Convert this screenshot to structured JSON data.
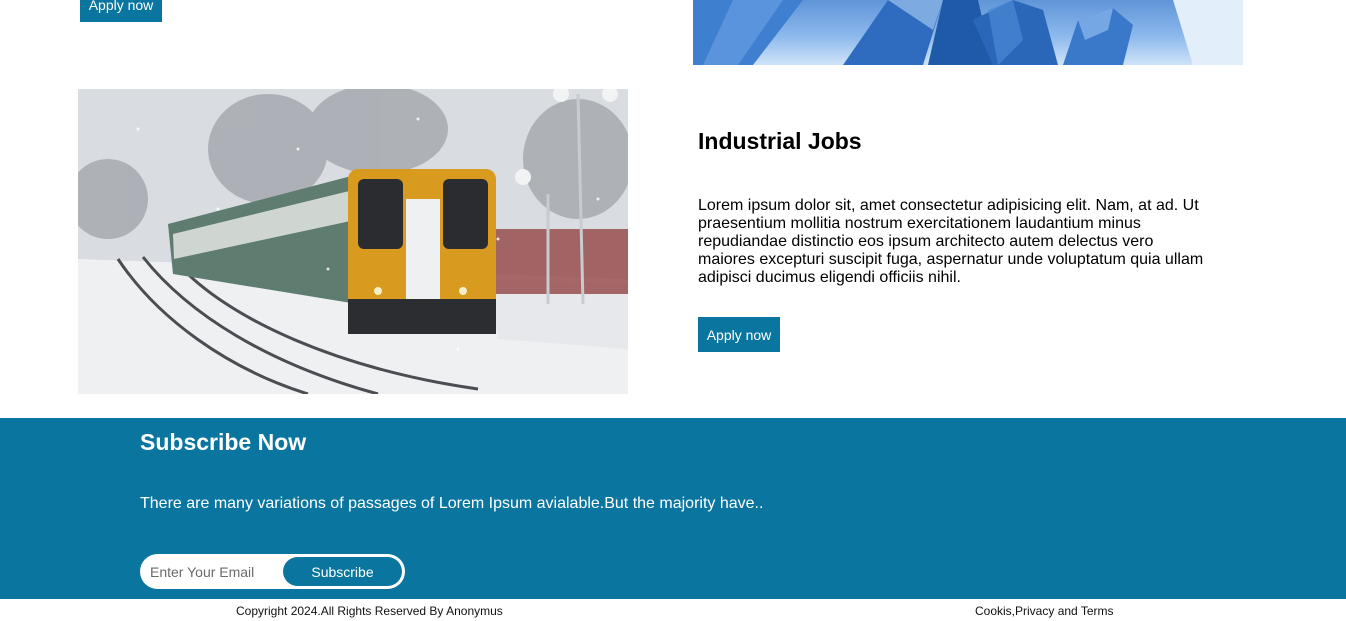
{
  "top_card": {
    "apply_label": "Apply now"
  },
  "industrial": {
    "title": "Industrial Jobs",
    "description": "Lorem ipsum dolor sit, amet consectetur adipisicing elit. Nam, at ad. Ut praesentium mollitia nostrum exercitationem laudantium minus repudiandae distinctio eos ipsum architecto autem delectus vero maiores excepturi suscipit fuga, aspernatur unde voluptatum quia ullam adipisci ducimus eligendi officiis nihil.",
    "apply_label": "Apply now"
  },
  "subscribe": {
    "title": "Subscribe Now",
    "text": "There are many variations of passages of Lorem Ipsum avialable.But the majority have..",
    "email_placeholder": "Enter Your Email",
    "button_label": "Subscribe",
    "background_color": "#0a76a0"
  },
  "footer": {
    "copyright": "Copyright 2024.All Rights Reserved By Anonymus",
    "links": "Cookis,Privacy and Terms"
  }
}
